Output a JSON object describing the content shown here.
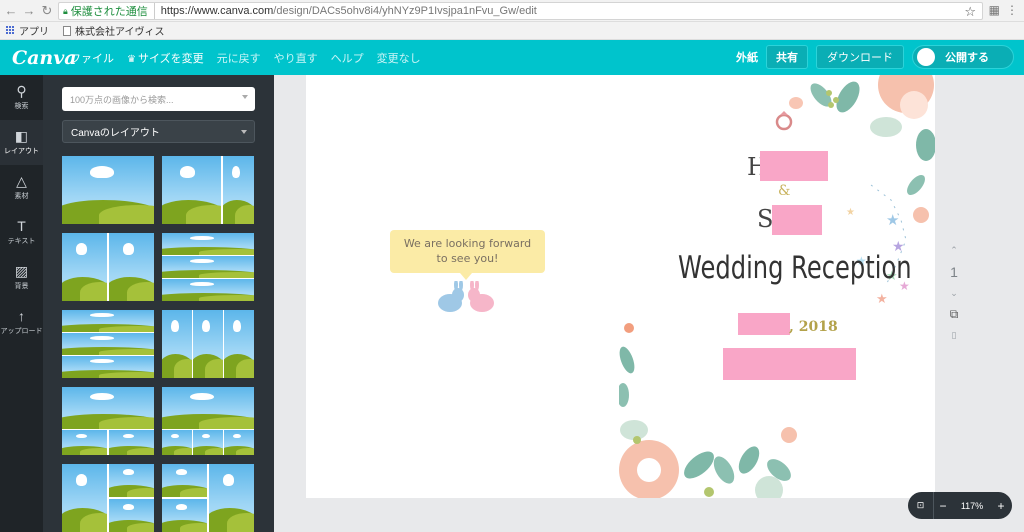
{
  "browser": {
    "secure_label": "保護された通信",
    "url_main": "https://www.canva.com",
    "url_path": "/design/DACs5ohv8i4/yhNYz9P1Ivsjpa1nFvu_Gw/edit",
    "bookmarks": [
      {
        "label": "アプリ",
        "icon": "apps-grid-icon"
      },
      {
        "label": "株式会社アイヴィス",
        "icon": "page-icon"
      }
    ]
  },
  "header": {
    "logo": "Canva",
    "menu": {
      "file": "ファイル",
      "resize": "サイズを変更",
      "undo": "元に戻す",
      "redo": "やり直す",
      "help": "ヘルプ",
      "status": "変更なし"
    },
    "right": {
      "gaiki": "外紙",
      "share": "共有",
      "download": "ダウンロード",
      "publish": "公開する"
    }
  },
  "rail": [
    {
      "label": "検索",
      "icon": "search-icon"
    },
    {
      "label": "レイアウト",
      "icon": "layout-icon"
    },
    {
      "label": "素材",
      "icon": "elements-icon"
    },
    {
      "label": "テキスト",
      "icon": "text-icon"
    },
    {
      "label": "背景",
      "icon": "background-icon"
    },
    {
      "label": "アップロード",
      "icon": "upload-icon"
    }
  ],
  "panel": {
    "search_placeholder": "100万点の画像から検索...",
    "layout_select": "Canvaのレイアウト"
  },
  "design": {
    "bubble_line1": "We are looking forward",
    "bubble_line2": "to see you!",
    "h_initial": "H",
    "ampersand": "&",
    "s_initial": "S",
    "wedding_title": "Wedding Reception",
    "year": ", 2018"
  },
  "side": {
    "page_number": "1"
  },
  "zoom": {
    "value": "117%",
    "minus": "−",
    "plus": "+"
  },
  "colors": {
    "brand": "#00c4cc",
    "dark_panel": "#2c3339",
    "rail": "#1f2428",
    "redaction": "#f9a6c7"
  }
}
